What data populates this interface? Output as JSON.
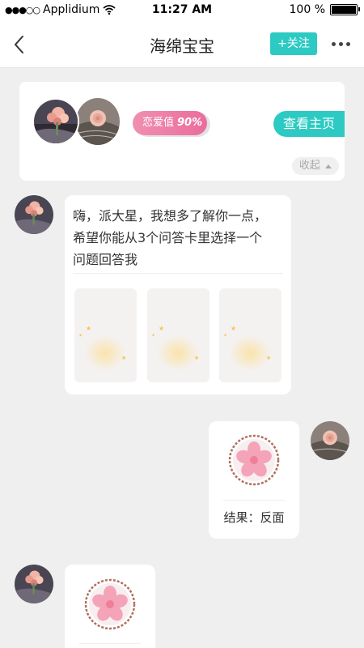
{
  "status_bar": {
    "signal": "●●●○○",
    "carrier": "Applidium",
    "time": "11:27 AM",
    "battery": "100 %",
    "battery_level": 1.0
  },
  "nav": {
    "title": "海绵宝宝",
    "follow_label": "+关注"
  },
  "match_card": {
    "love_label": "恋爱值",
    "love_value": "90%",
    "homepage_label": "查看主页",
    "collapse_label": "收起"
  },
  "messages": [
    {
      "side": "left",
      "text_lines": [
        "嗨，派大星，我想多了解你一点，",
        "希望你能从3个问答卡里选择一个",
        "问题回答我"
      ],
      "card_count": 3
    },
    {
      "side": "right",
      "result": "结果：反面"
    },
    {
      "side": "left",
      "type": "coin"
    }
  ],
  "colors": {
    "accent": "#2ccac2",
    "love_pink": "#ea6d9b",
    "background": "#efefef"
  }
}
